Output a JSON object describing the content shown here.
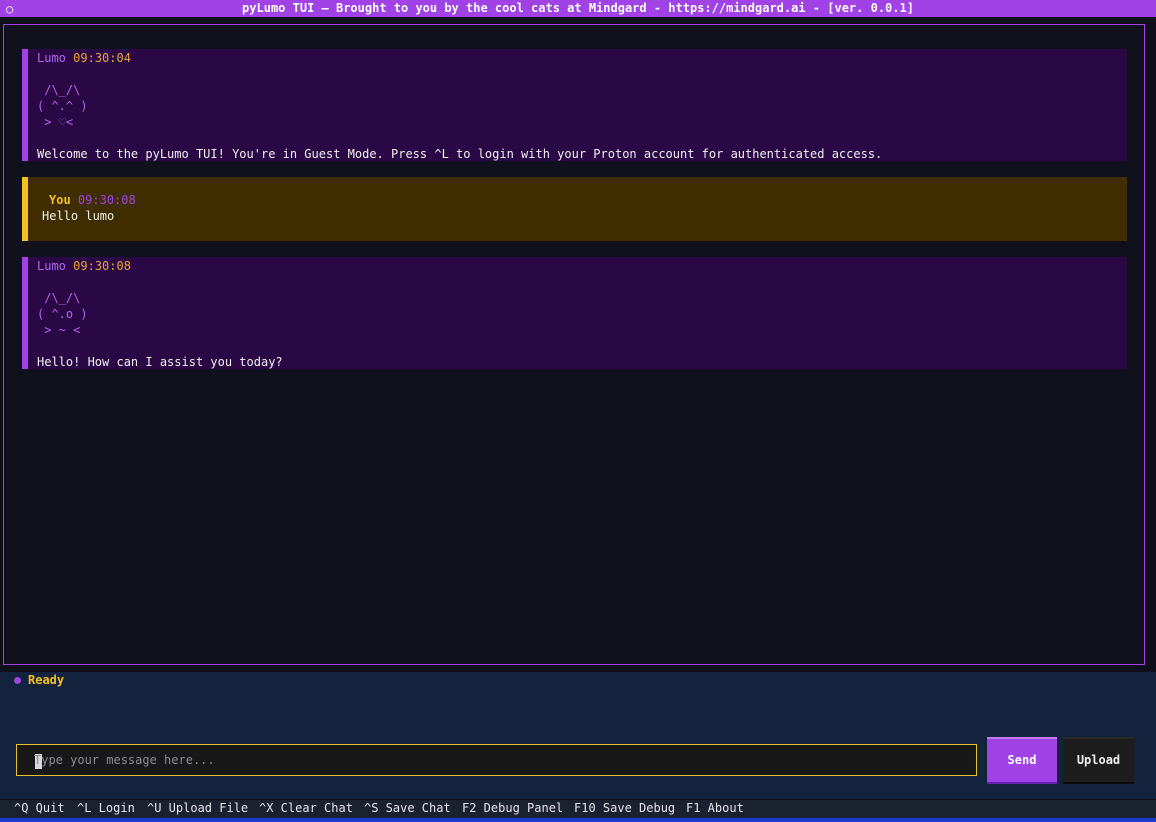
{
  "window": {
    "icon": "○",
    "title": "pyLumo TUI — Brought to you by the cool cats at Mindgard - https://mindgard.ai - [ver. 0.0.1]"
  },
  "messages": [
    {
      "author": "Lumo",
      "time": "09:30:04",
      "ascii": [
        " /\\_/\\",
        "( ^.^ )",
        " > ♡<"
      ],
      "text": "Welcome to the pyLumo TUI! You're in Guest Mode. Press ^L to login with your Proton account for authenticated access."
    },
    {
      "author": "You",
      "time": "09:30:08",
      "text": "Hello lumo"
    },
    {
      "author": "Lumo",
      "time": "09:30:08",
      "ascii": [
        " /\\_/\\",
        "( ^.o )",
        " > ~ <"
      ],
      "text": "Hello! How can I assist you today?"
    }
  ],
  "status": {
    "text": "Ready",
    "dot_color": "#a142e6"
  },
  "composer": {
    "placeholder": "Type your message here...",
    "value": "",
    "send_label": "Send",
    "upload_label": "Upload"
  },
  "footer": {
    "bindings": [
      "^Q Quit",
      "^L Login",
      "^U Upload File",
      "^X Clear Chat",
      "^S Save Chat",
      "F2 Debug Panel",
      "F10 Save Debug",
      "F1 About"
    ]
  },
  "colors": {
    "accent": "#a142e6",
    "user_accent": "#f2c318",
    "timestamp": "#e8a23c"
  }
}
